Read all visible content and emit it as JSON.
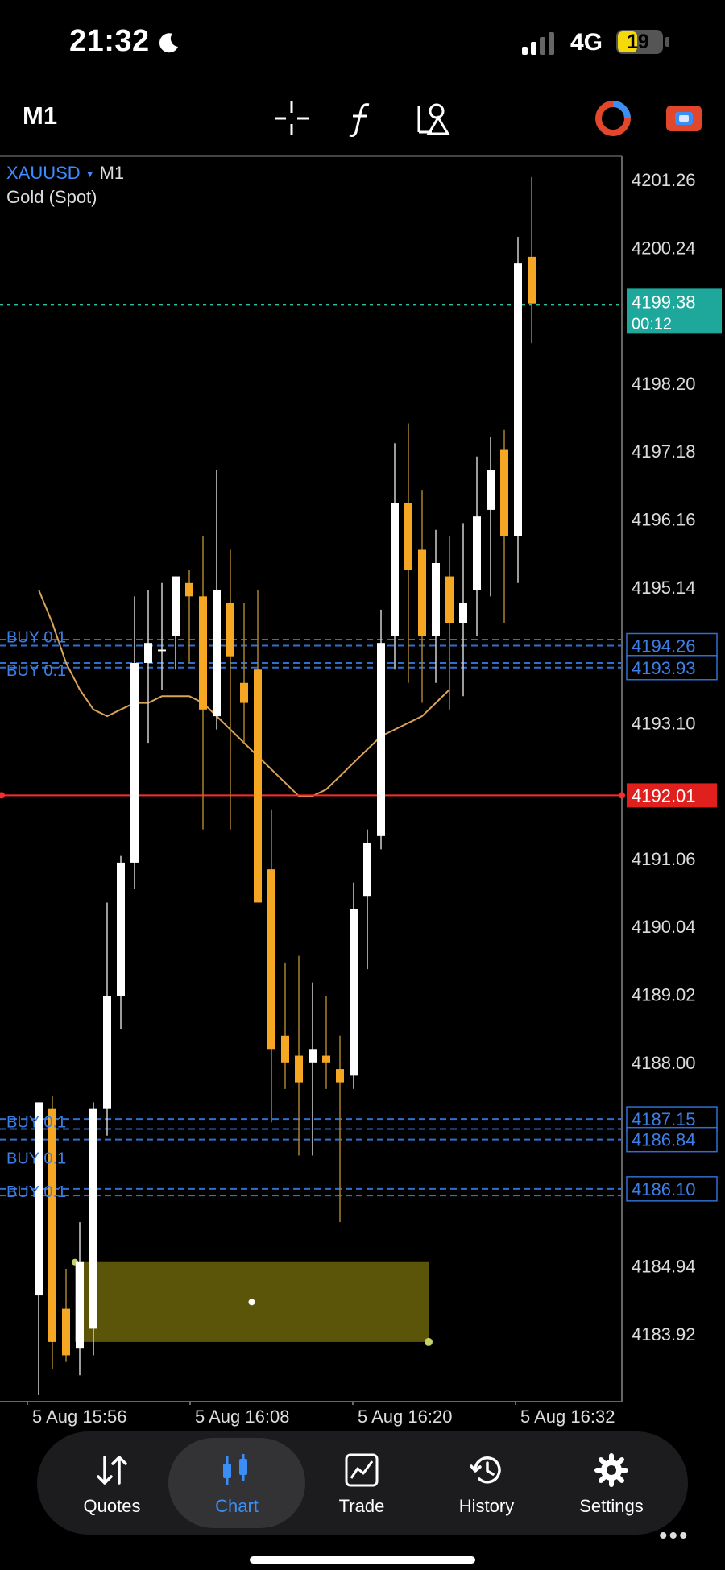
{
  "status": {
    "time": "21:32",
    "network": "4G",
    "battery": "19"
  },
  "toolbar": {
    "timeframe": "M1",
    "icons": [
      "crosshair-icon",
      "indicator-f-icon",
      "objects-icon",
      "account-switch-icon",
      "trade-icon"
    ]
  },
  "chart": {
    "symbol": "XAUUSD",
    "timeframe": "M1",
    "name": "Gold (Spot)",
    "price_axis": [
      "4201.26",
      "4200.24",
      "4199.38",
      "4198.20",
      "4197.18",
      "4196.16",
      "4195.14",
      "4194.26",
      "4193.93",
      "4193.10",
      "4192.01",
      "4191.06",
      "4190.04",
      "4189.02",
      "4188.00",
      "4187.15",
      "4186.84",
      "4186.10",
      "4184.94",
      "4183.92"
    ],
    "current_price": "4199.38",
    "countdown": "00:12",
    "level_price": "4192.01",
    "order_label": "BUY 0.1",
    "time_axis": [
      "5 Aug 15:56",
      "5 Aug 16:08",
      "5 Aug 16:20",
      "5 Aug 16:32"
    ],
    "colors": {
      "bull": "#ffffff",
      "bear": "#f5a623",
      "ma": "#d9a35a",
      "ask_line": "#2fbf9f",
      "level": "#ff2a2a",
      "order": "#2f6fd0"
    }
  },
  "chart_data": {
    "type": "candlestick",
    "title": "XAUUSD M1",
    "price_range": [
      4183.0,
      4201.8
    ],
    "candles": [
      {
        "o": 4184.5,
        "h": 4186.6,
        "l": 4183.0,
        "c": 4187.4
      },
      {
        "o": 4187.3,
        "h": 4187.5,
        "l": 4183.4,
        "c": 4183.8
      },
      {
        "o": 4184.3,
        "h": 4184.9,
        "l": 4183.5,
        "c": 4183.6
      },
      {
        "o": 4183.7,
        "h": 4185.6,
        "l": 4183.3,
        "c": 4185.0
      },
      {
        "o": 4184.0,
        "h": 4187.4,
        "l": 4183.6,
        "c": 4187.3
      },
      {
        "o": 4187.3,
        "h": 4190.4,
        "l": 4186.9,
        "c": 4189.0
      },
      {
        "o": 4189.0,
        "h": 4191.1,
        "l": 4188.5,
        "c": 4191.0
      },
      {
        "o": 4191.0,
        "h": 4195.0,
        "l": 4190.6,
        "c": 4194.0
      },
      {
        "o": 4194.0,
        "h": 4195.1,
        "l": 4192.8,
        "c": 4194.3
      },
      {
        "o": 4194.2,
        "h": 4195.2,
        "l": 4193.6,
        "c": 4194.2
      },
      {
        "o": 4194.4,
        "h": 4195.3,
        "l": 4193.9,
        "c": 4195.3
      },
      {
        "o": 4195.2,
        "h": 4195.4,
        "l": 4194.0,
        "c": 4195.0
      },
      {
        "o": 4195.0,
        "h": 4195.9,
        "l": 4191.5,
        "c": 4193.3
      },
      {
        "o": 4193.2,
        "h": 4196.9,
        "l": 4193.0,
        "c": 4195.1
      },
      {
        "o": 4194.9,
        "h": 4195.7,
        "l": 4191.5,
        "c": 4194.1
      },
      {
        "o": 4193.7,
        "h": 4194.9,
        "l": 4192.8,
        "c": 4193.4
      },
      {
        "o": 4193.9,
        "h": 4195.1,
        "l": 4191.5,
        "c": 4190.4
      },
      {
        "o": 4190.9,
        "h": 4191.8,
        "l": 4187.1,
        "c": 4188.2
      },
      {
        "o": 4188.4,
        "h": 4189.5,
        "l": 4187.6,
        "c": 4188.0
      },
      {
        "o": 4188.1,
        "h": 4189.6,
        "l": 4186.6,
        "c": 4187.7
      },
      {
        "o": 4188.0,
        "h": 4189.2,
        "l": 4186.6,
        "c": 4188.2
      },
      {
        "o": 4188.1,
        "h": 4189.0,
        "l": 4187.6,
        "c": 4188.0
      },
      {
        "o": 4187.9,
        "h": 4188.4,
        "l": 4185.6,
        "c": 4187.7
      },
      {
        "o": 4187.8,
        "h": 4190.7,
        "l": 4187.6,
        "c": 4190.3
      },
      {
        "o": 4190.5,
        "h": 4191.5,
        "l": 4189.4,
        "c": 4191.3
      },
      {
        "o": 4191.4,
        "h": 4194.8,
        "l": 4191.2,
        "c": 4194.3
      },
      {
        "o": 4194.4,
        "h": 4197.3,
        "l": 4193.9,
        "c": 4196.4
      },
      {
        "o": 4196.4,
        "h": 4197.6,
        "l": 4193.7,
        "c": 4195.4
      },
      {
        "o": 4195.7,
        "h": 4196.6,
        "l": 4193.4,
        "c": 4194.4
      },
      {
        "o": 4194.4,
        "h": 4196.0,
        "l": 4193.7,
        "c": 4195.5
      },
      {
        "o": 4195.3,
        "h": 4195.9,
        "l": 4193.3,
        "c": 4194.6
      },
      {
        "o": 4194.6,
        "h": 4196.1,
        "l": 4193.5,
        "c": 4194.9
      },
      {
        "o": 4195.1,
        "h": 4197.1,
        "l": 4194.4,
        "c": 4196.2
      },
      {
        "o": 4196.3,
        "h": 4197.4,
        "l": 4195.0,
        "c": 4196.9
      },
      {
        "o": 4197.2,
        "h": 4197.5,
        "l": 4194.6,
        "c": 4195.9
      },
      {
        "o": 4195.9,
        "h": 4200.4,
        "l": 4195.2,
        "c": 4200.0
      },
      {
        "o": 4200.1,
        "h": 4201.3,
        "l": 4198.8,
        "c": 4199.4
      }
    ],
    "moving_average": [
      4195.1,
      4194.6,
      4194.0,
      4193.6,
      4193.3,
      4193.2,
      4193.3,
      4193.4,
      4193.4,
      4193.5,
      4193.5,
      4193.5,
      4193.4,
      4193.2,
      4193.0,
      4192.8,
      4192.6,
      4192.4,
      4192.2,
      4192.0,
      4192.0,
      4192.1,
      4192.3,
      4192.5,
      4192.7,
      4192.9,
      4193.0,
      4193.1,
      4193.2,
      4193.4,
      4193.6
    ],
    "order_levels": [
      4194.35,
      4194.26,
      4194.0,
      4193.93,
      4187.15,
      4187.0,
      4186.84,
      4186.1,
      4186.0
    ],
    "price_line": 4199.38,
    "horizontal_level": 4192.01,
    "rectangle": {
      "price_top": 4185.0,
      "price_bottom": 4183.8,
      "time_start_candle": 3,
      "time_end_candle": 28
    }
  },
  "nav": [
    {
      "label": "Quotes",
      "icon": "quotes-icon"
    },
    {
      "label": "Chart",
      "icon": "chart-icon",
      "active": true
    },
    {
      "label": "Trade",
      "icon": "trade-chart-icon"
    },
    {
      "label": "History",
      "icon": "history-icon"
    },
    {
      "label": "Settings",
      "icon": "settings-icon"
    }
  ]
}
